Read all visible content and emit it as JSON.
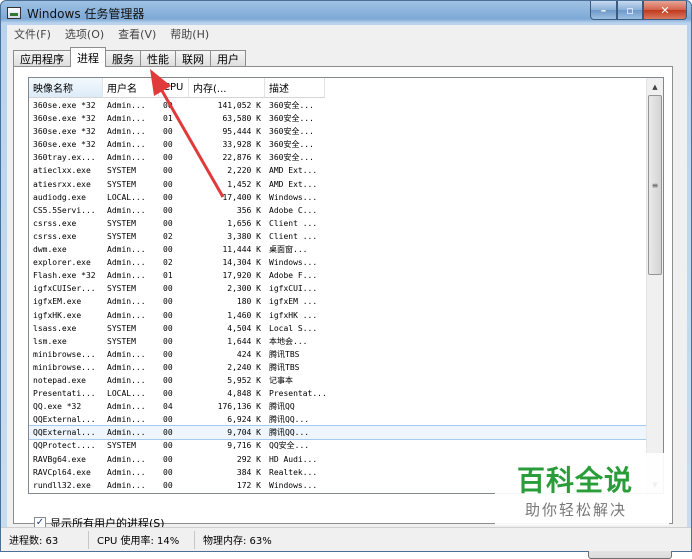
{
  "window": {
    "title": "Windows 任务管理器"
  },
  "window_buttons": {
    "minimize": "–",
    "maximize": "▫",
    "close": "✕"
  },
  "menu": [
    "文件(F)",
    "选项(O)",
    "查看(V)",
    "帮助(H)"
  ],
  "tabs": [
    {
      "label": "应用程序",
      "active": false
    },
    {
      "label": "进程",
      "active": true
    },
    {
      "label": "服务",
      "active": false
    },
    {
      "label": "性能",
      "active": false
    },
    {
      "label": "联网",
      "active": false
    },
    {
      "label": "用户",
      "active": false
    }
  ],
  "columns": [
    "映像名称",
    "用户名",
    "CPU",
    "内存(...",
    "描述"
  ],
  "processes": [
    [
      "360se.exe *32",
      "Admin...",
      "00",
      "141,052 K",
      "360安全..."
    ],
    [
      "360se.exe *32",
      "Admin...",
      "01",
      "63,580 K",
      "360安全..."
    ],
    [
      "360se.exe *32",
      "Admin...",
      "00",
      "95,444 K",
      "360安全..."
    ],
    [
      "360se.exe *32",
      "Admin...",
      "00",
      "33,928 K",
      "360安全..."
    ],
    [
      "360tray.ex...",
      "Admin...",
      "00",
      "22,876 K",
      "360安全..."
    ],
    [
      "atieclxx.exe",
      "SYSTEM",
      "00",
      "2,220 K",
      "AMD Ext..."
    ],
    [
      "atiesrxx.exe",
      "SYSTEM",
      "00",
      "1,452 K",
      "AMD Ext..."
    ],
    [
      "audiodg.exe",
      "LOCAL...",
      "00",
      "17,400 K",
      "Windows..."
    ],
    [
      "CS5.5Servi...",
      "Admin...",
      "00",
      "356 K",
      "Adobe C..."
    ],
    [
      "csrss.exe",
      "SYSTEM",
      "00",
      "1,656 K",
      "Client ..."
    ],
    [
      "csrss.exe",
      "SYSTEM",
      "02",
      "3,380 K",
      "Client ..."
    ],
    [
      "dwm.exe",
      "Admin...",
      "00",
      "11,444 K",
      "桌面窗..."
    ],
    [
      "explorer.exe",
      "Admin...",
      "02",
      "14,304 K",
      "Windows..."
    ],
    [
      "Flash.exe *32",
      "Admin...",
      "01",
      "17,920 K",
      "Adobe F..."
    ],
    [
      "igfxCUISer...",
      "SYSTEM",
      "00",
      "2,300 K",
      "igfxCUI..."
    ],
    [
      "igfxEM.exe",
      "Admin...",
      "00",
      "180 K",
      "igfxEM ..."
    ],
    [
      "igfxHK.exe",
      "Admin...",
      "00",
      "1,460 K",
      "igfxHK ..."
    ],
    [
      "lsass.exe",
      "SYSTEM",
      "00",
      "4,504 K",
      "Local S..."
    ],
    [
      "lsm.exe",
      "SYSTEM",
      "00",
      "1,644 K",
      "本地会..."
    ],
    [
      "minibrowse...",
      "Admin...",
      "00",
      "424 K",
      "腾讯TBS"
    ],
    [
      "minibrowse...",
      "Admin...",
      "00",
      "2,240 K",
      "腾讯TBS"
    ],
    [
      "notepad.exe",
      "Admin...",
      "00",
      "5,952 K",
      "记事本"
    ],
    [
      "Presentati...",
      "LOCAL...",
      "00",
      "4,848 K",
      "Presentat..."
    ],
    [
      "QQ.exe *32",
      "Admin...",
      "04",
      "176,136 K",
      "腾讯QQ"
    ],
    [
      "QQExternal...",
      "Admin...",
      "00",
      "6,924 K",
      "腾讯QQ..."
    ],
    [
      "QQExternal...",
      "Admin...",
      "00",
      "9,704 K",
      "腾讯QQ..."
    ],
    [
      "QQProtect....",
      "SYSTEM",
      "00",
      "9,716 K",
      "QQ安全..."
    ],
    [
      "RAVBg64.exe",
      "Admin...",
      "00",
      "292 K",
      "HD Audi..."
    ],
    [
      "RAVCpl64.exe",
      "Admin...",
      "00",
      "384 K",
      "Realtek..."
    ],
    [
      "rundll32.exe",
      "Admin...",
      "00",
      "172 K",
      "Windows..."
    ]
  ],
  "selected_row": 25,
  "show_all_users": {
    "checked": true,
    "label": "显示所有用户的进程(S)"
  },
  "status": {
    "process_count": "进程数: 63",
    "cpu_usage": "CPU 使用率: 14%",
    "memory": "物理内存: 63%"
  },
  "watermark": {
    "title": "百科全说",
    "subtitle": "助你轻松解决"
  },
  "colors": {
    "arrow": "#e03a3a",
    "watermark_green": "#2a9d3a",
    "selection": "#eef5fd"
  }
}
